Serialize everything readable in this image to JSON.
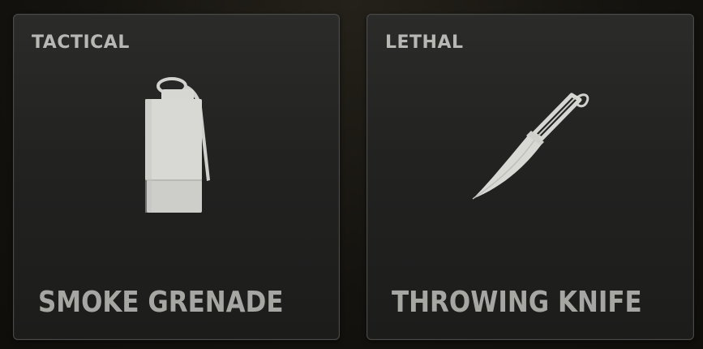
{
  "slots": [
    {
      "category": "TACTICAL",
      "item_name": "SMOKE GRENADE",
      "icon": "smoke-grenade-icon"
    },
    {
      "category": "LETHAL",
      "item_name": "THROWING KNIFE",
      "icon": "throwing-knife-icon"
    }
  ],
  "colors": {
    "background": "#16140f",
    "card": "#252524",
    "card_border": "#4a4a48",
    "label_text": "#b7b7b4",
    "name_text": "#a6a6a3",
    "icon_fill": "#d8d8d5"
  }
}
